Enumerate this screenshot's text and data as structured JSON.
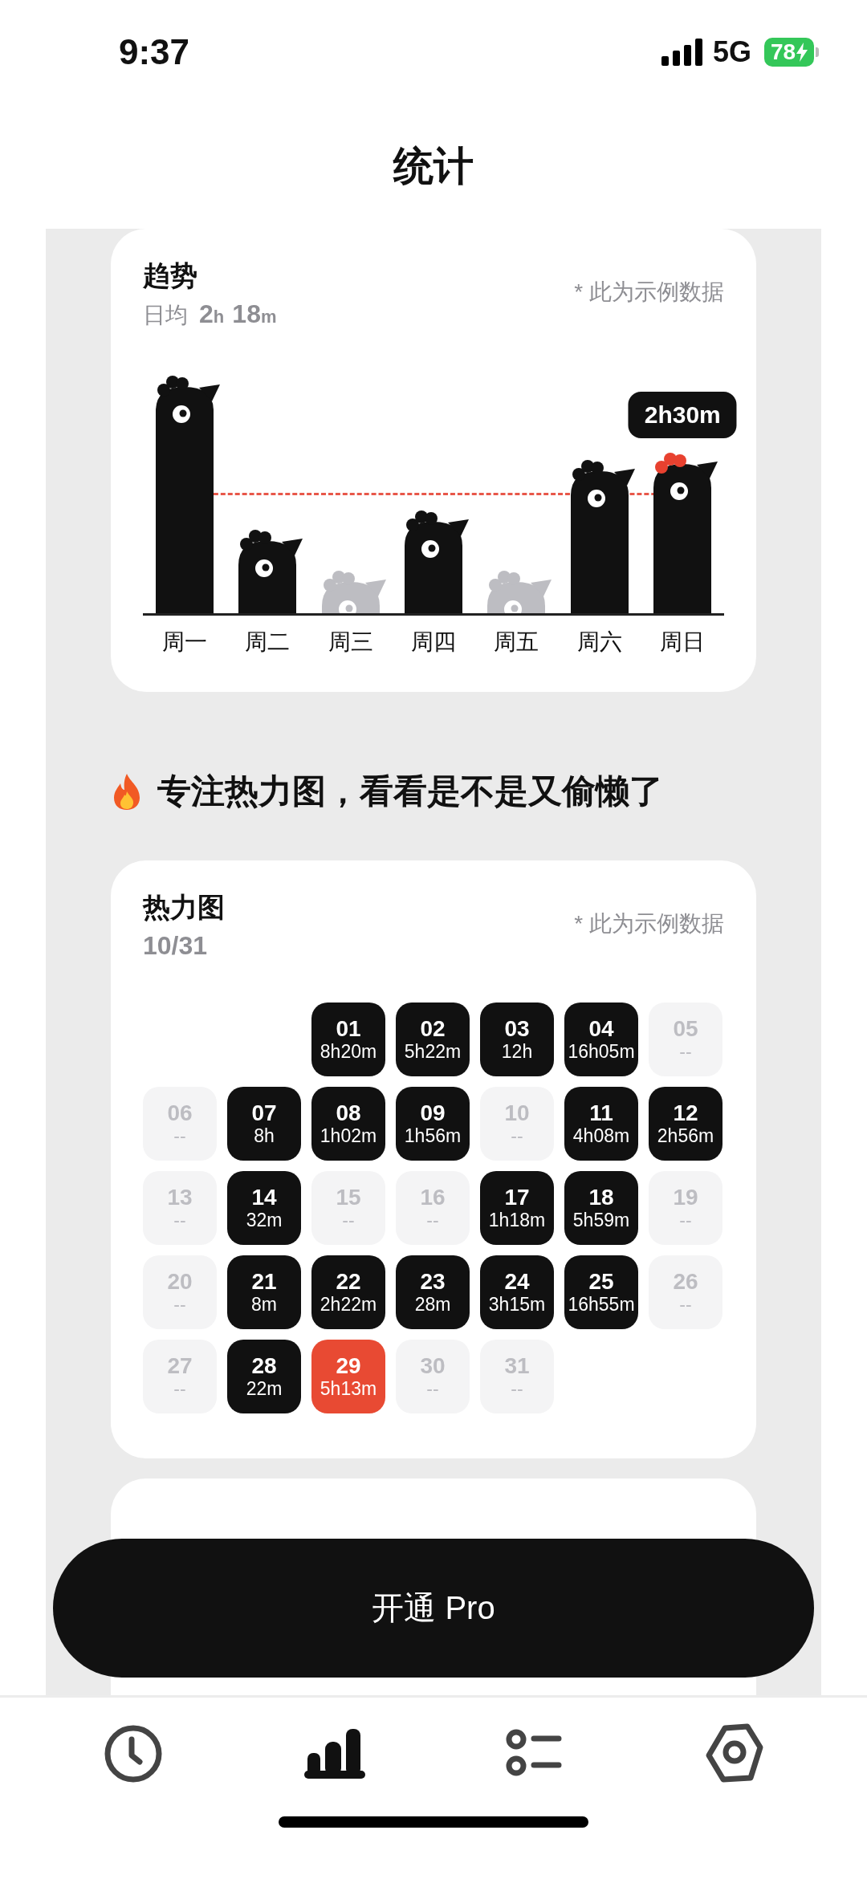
{
  "status_bar": {
    "time": "9:37",
    "network": "5G",
    "battery": "78",
    "charging": true
  },
  "title": "统计",
  "trend": {
    "title": "趋势",
    "average_label": "日均",
    "average_value": "2h 18m",
    "note": "* 此为示例数据",
    "days": [
      {
        "label": "周一",
        "level": 0.94,
        "kind": "active",
        "selected": false
      },
      {
        "label": "周二",
        "level": 0.3,
        "kind": "active",
        "selected": false
      },
      {
        "label": "周三",
        "level": 0.13,
        "kind": "empty",
        "selected": false
      },
      {
        "label": "周四",
        "level": 0.38,
        "kind": "active",
        "selected": false
      },
      {
        "label": "周五",
        "level": 0.13,
        "kind": "empty",
        "selected": false
      },
      {
        "label": "周六",
        "level": 0.59,
        "kind": "active",
        "selected": false
      },
      {
        "label": "周日",
        "level": 0.62,
        "kind": "active",
        "selected": true,
        "tooltip": "2h30m"
      }
    ]
  },
  "section_heading": "专注热力图，看看是不是又偷懒了",
  "heatmap": {
    "title": "热力图",
    "date": "10/31",
    "note": "* 此为示例数据",
    "days": [
      {
        "day": "01",
        "value": "8h20m",
        "kind": "active"
      },
      {
        "day": "02",
        "value": "5h22m",
        "kind": "active"
      },
      {
        "day": "03",
        "value": "12h",
        "kind": "active"
      },
      {
        "day": "04",
        "value": "16h05m",
        "kind": "active"
      },
      {
        "day": "05",
        "value": "--",
        "kind": "empty"
      },
      {
        "day": "06",
        "value": "--",
        "kind": "empty"
      },
      {
        "day": "07",
        "value": "8h",
        "kind": "active"
      },
      {
        "day": "08",
        "value": "1h02m",
        "kind": "active"
      },
      {
        "day": "09",
        "value": "1h56m",
        "kind": "active"
      },
      {
        "day": "10",
        "value": "--",
        "kind": "empty"
      },
      {
        "day": "11",
        "value": "4h08m",
        "kind": "active"
      },
      {
        "day": "12",
        "value": "2h56m",
        "kind": "active"
      },
      {
        "day": "13",
        "value": "--",
        "kind": "empty"
      },
      {
        "day": "14",
        "value": "32m",
        "kind": "active"
      },
      {
        "day": "15",
        "value": "--",
        "kind": "empty"
      },
      {
        "day": "16",
        "value": "--",
        "kind": "empty"
      },
      {
        "day": "17",
        "value": "1h18m",
        "kind": "active"
      },
      {
        "day": "18",
        "value": "5h59m",
        "kind": "active"
      },
      {
        "day": "19",
        "value": "--",
        "kind": "empty"
      },
      {
        "day": "20",
        "value": "--",
        "kind": "empty"
      },
      {
        "day": "21",
        "value": "8m",
        "kind": "active"
      },
      {
        "day": "22",
        "value": "2h22m",
        "kind": "active"
      },
      {
        "day": "23",
        "value": "28m",
        "kind": "active"
      },
      {
        "day": "24",
        "value": "3h15m",
        "kind": "active"
      },
      {
        "day": "25",
        "value": "16h55m",
        "kind": "active"
      },
      {
        "day": "26",
        "value": "--",
        "kind": "empty"
      },
      {
        "day": "27",
        "value": "--",
        "kind": "empty"
      },
      {
        "day": "28",
        "value": "22m",
        "kind": "active"
      },
      {
        "day": "29",
        "value": "5h13m",
        "kind": "today"
      },
      {
        "day": "30",
        "value": "--",
        "kind": "empty"
      },
      {
        "day": "31",
        "value": "--",
        "kind": "empty"
      }
    ]
  },
  "pro_button": "开通 Pro",
  "tab_bar": [
    {
      "kind": "clock",
      "selected": false
    },
    {
      "kind": "stats",
      "selected": true
    },
    {
      "kind": "list",
      "selected": false
    },
    {
      "kind": "settings",
      "selected": false
    }
  ]
}
